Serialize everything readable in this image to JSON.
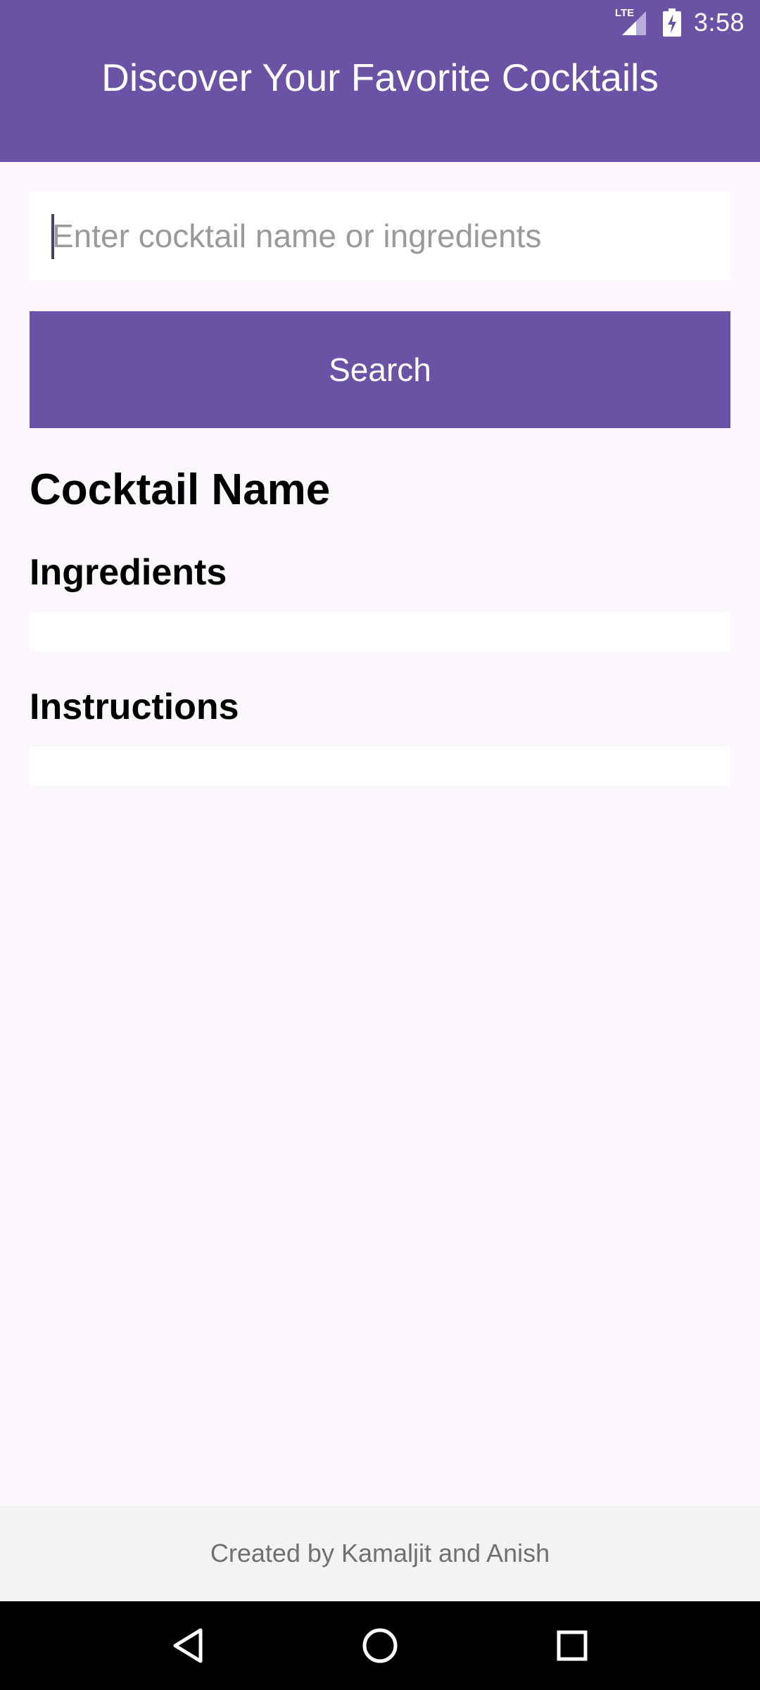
{
  "status_bar": {
    "network": "LTE",
    "time": "3:58",
    "icons": [
      "lte-signal-icon",
      "battery-charging-icon"
    ]
  },
  "header": {
    "title": "Discover Your Favorite Cocktails",
    "color": "#6a52a5"
  },
  "search": {
    "placeholder": "Enter cocktail name or ingredients",
    "value": "",
    "button_label": "Search"
  },
  "result": {
    "name_heading": "Cocktail Name",
    "ingredients_heading": "Ingredients",
    "ingredients_text": "",
    "instructions_heading": "Instructions",
    "instructions_text": ""
  },
  "footer": {
    "text": "Created by Kamaljit and Anish"
  },
  "nav": {
    "icons": [
      "back-icon",
      "home-icon",
      "recents-icon"
    ]
  }
}
